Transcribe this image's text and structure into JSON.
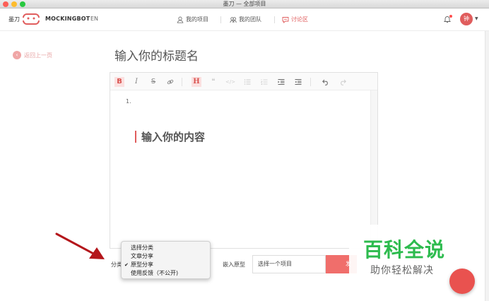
{
  "window": {
    "title": "墨刀 — 全部项目"
  },
  "nav": {
    "brand_cn": "墨刀",
    "brand_name": "MOCKINGBOT",
    "lang": "EN",
    "items": [
      {
        "label": "我的项目"
      },
      {
        "label": "我的团队"
      },
      {
        "label": "讨论区"
      }
    ],
    "avatar_text": "钟",
    "active_color": "#e05d5d"
  },
  "back": {
    "label": "返回上一页"
  },
  "post": {
    "title_placeholder": "输入你的标题名",
    "content_placeholder": "输入你的内容",
    "list_marker": "1."
  },
  "toolbar": {
    "bold": "B",
    "italic": "I",
    "strike": "S",
    "heading": "H",
    "quote": "❝",
    "code": "</>"
  },
  "bottom": {
    "category_label": "分类",
    "embed_label": "嵌入原型",
    "project_select": "选择一个项目",
    "publish_label": "发",
    "category_options": [
      {
        "label": "选择分类",
        "checked": false
      },
      {
        "label": "文章分享",
        "checked": false
      },
      {
        "label": "原型分享",
        "checked": true
      },
      {
        "label": "使用反馈（不公开)",
        "checked": false
      }
    ]
  },
  "watermark": {
    "big": "百科全说",
    "small": "助你轻松解决"
  }
}
